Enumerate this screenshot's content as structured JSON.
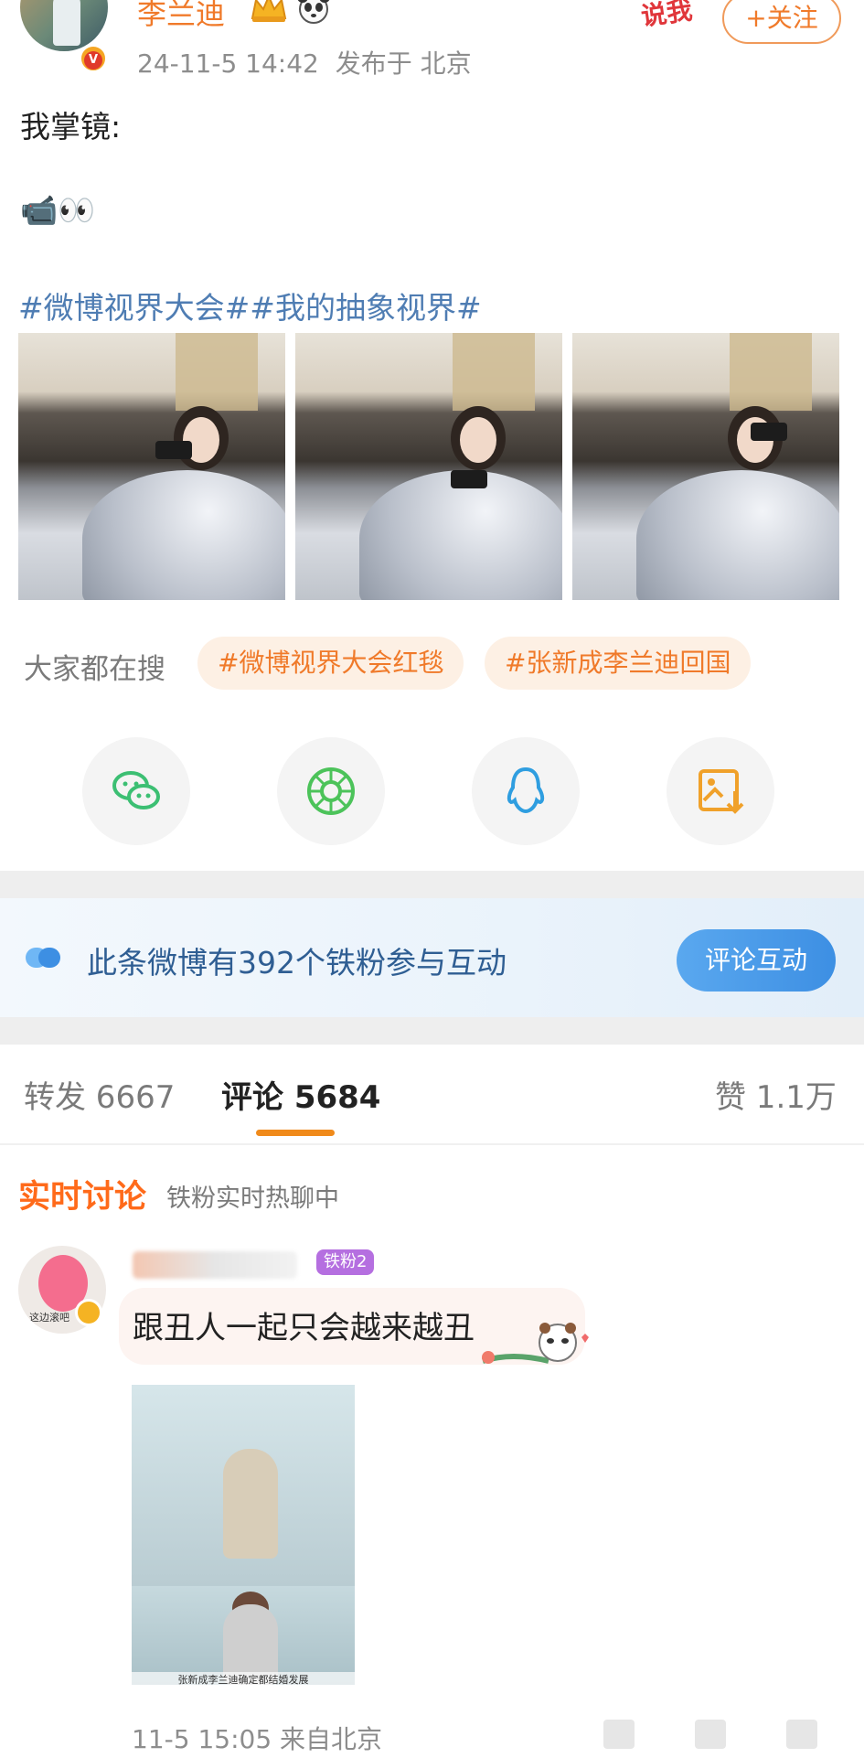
{
  "post": {
    "username": "李兰迪",
    "time": "24-11-5 14:42",
    "location": "发布于 北京",
    "follow_label": "+关注",
    "sticker_text": "说我",
    "text_line1": "我掌镜:",
    "text_line2": "📹👀",
    "hashtags": "#微博视界大会##我的抽象视界#"
  },
  "trending": {
    "label": "大家都在搜",
    "chips": [
      "#微博视界大会红毯",
      "#张新成李兰迪回国"
    ]
  },
  "share": {
    "icons": [
      "wechat-icon",
      "moments-icon",
      "qq-icon",
      "save-image-icon"
    ],
    "colors": {
      "wechat": "#3cbf73",
      "moments": "#4cc35a",
      "qq": "#2f9ee0",
      "save": "#f0a12a"
    }
  },
  "fans_banner": {
    "text": "此条微博有392个铁粉参与互动",
    "button": "评论互动"
  },
  "tabs": {
    "repost": "转发 6667",
    "comment": "评论 5684",
    "like": "赞 1.1万"
  },
  "live": {
    "title": "实时讨论",
    "subtitle": "铁粉实时热聊中"
  },
  "comment": {
    "badge": "铁粉2",
    "avatar_caption": "这边滚吧",
    "text": "跟丑人一起只会越来越丑",
    "image_caption": "张新成李兰迪确定都结婚发展",
    "meta": "11-5 15:05 来自北京"
  },
  "theme": {
    "accent": "#f07a2a",
    "link": "#4f7db3",
    "banner_text": "#2f5e93"
  }
}
